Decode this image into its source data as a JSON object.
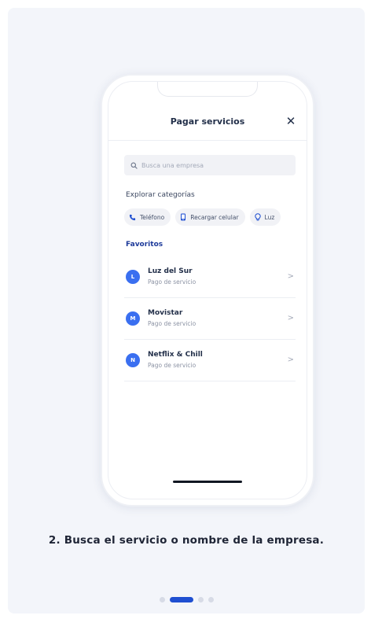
{
  "screen": {
    "title": "Pagar servicios",
    "close_symbol": "✕",
    "search": {
      "placeholder": "Busca una empresa"
    },
    "explore_title": "Explorar categorías",
    "categories": [
      {
        "label": "Teléfono",
        "icon": "phone-icon"
      },
      {
        "label": "Recargar celular",
        "icon": "mobile-icon"
      },
      {
        "label": "Luz",
        "icon": "lightbulb-icon"
      }
    ],
    "favorites_title": "Favoritos",
    "favorites": [
      {
        "initial": "L",
        "name": "Luz del Sur",
        "subtitle": "Pago de servicio"
      },
      {
        "initial": "M",
        "name": "Movistar",
        "subtitle": "Pago de servicio"
      },
      {
        "initial": "N",
        "name": "Netflix & Chill",
        "subtitle": "Pago de servicio"
      }
    ]
  },
  "caption": "2. Busca el servicio o nombre de la empresa.",
  "pagination": {
    "total": 4,
    "active_index": 1
  },
  "colors": {
    "accent": "#1f4fd1",
    "avatar": "#3a6ff0",
    "card_bg": "#f3f5fa"
  }
}
